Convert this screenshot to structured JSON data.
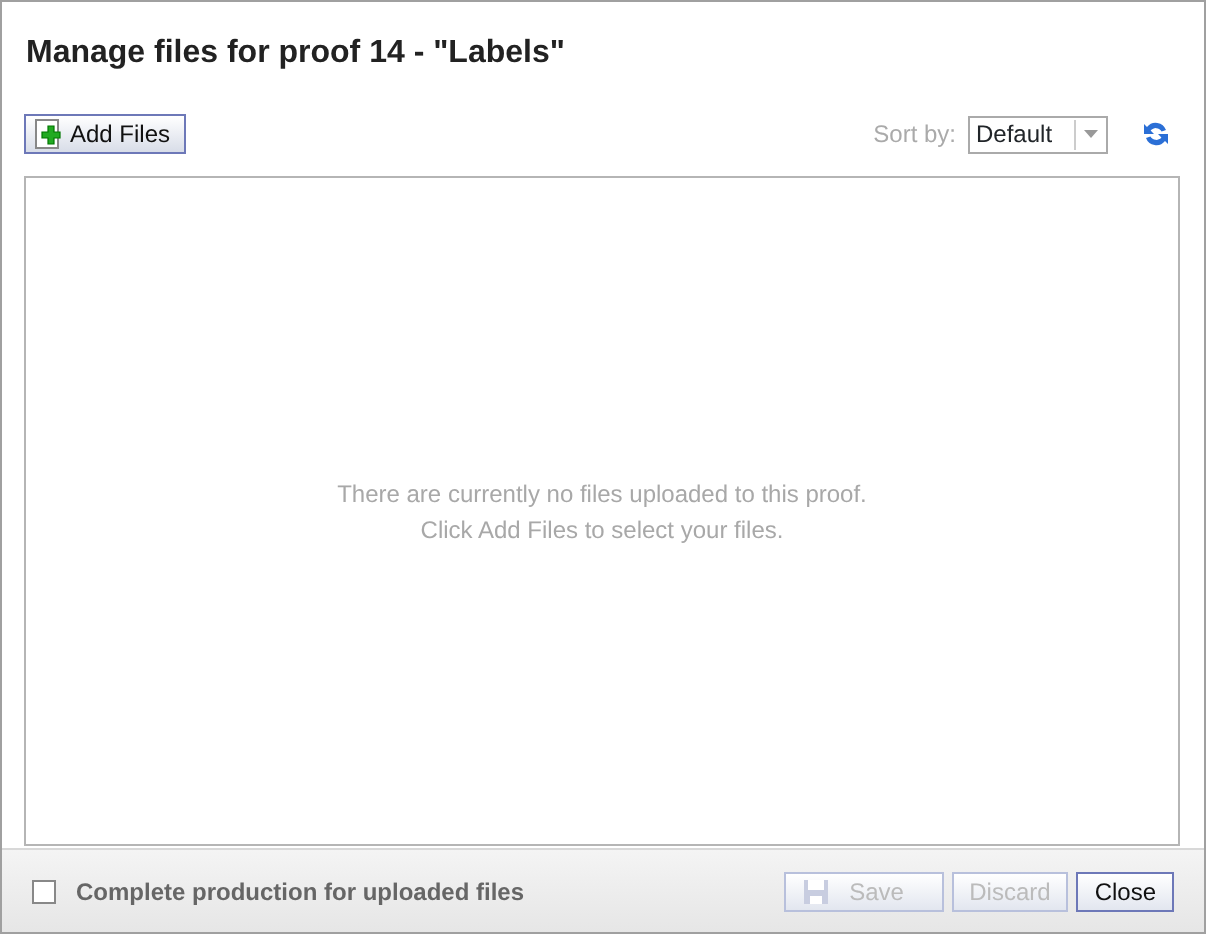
{
  "dialog": {
    "title": "Manage files for proof 14 - \"Labels\""
  },
  "toolbar": {
    "add_button": "Add Files",
    "sort_label": "Sort by:",
    "sort_value": "Default"
  },
  "empty_message": [
    "There are currently no files uploaded to this proof.",
    "Click Add Files to select your files."
  ],
  "footer": {
    "checkbox": {
      "label": "Complete production for uploaded files",
      "checked": false
    },
    "buttons": [
      {
        "label": "Save",
        "kind": "save",
        "disabled": true
      },
      {
        "label": "Discard",
        "kind": "plain",
        "disabled": true
      },
      {
        "label": "Close",
        "kind": "plain",
        "disabled": false
      }
    ]
  }
}
